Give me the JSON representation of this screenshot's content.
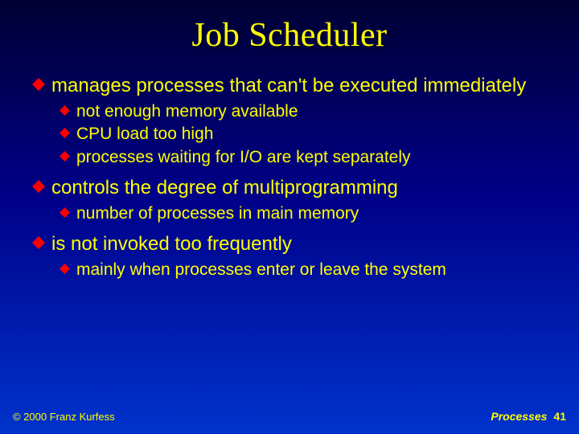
{
  "title": "Job Scheduler",
  "bullets": {
    "b1": "manages processes that can't be executed immediately",
    "b1a": "not enough memory available",
    "b1b": "CPU load too high",
    "b1c": "processes waiting for I/O are kept separately",
    "b2": "controls the degree of multiprogramming",
    "b2a": "number of processes in main memory",
    "b3": "is not invoked too frequently",
    "b3a": "mainly when processes enter or leave the system"
  },
  "footer": "© 2000 Franz Kurfess",
  "page": {
    "label": "Processes",
    "number": "41"
  }
}
